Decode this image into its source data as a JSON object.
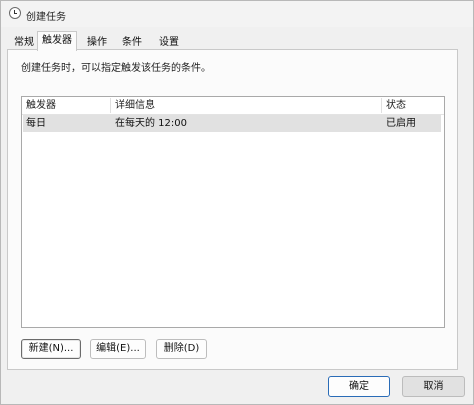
{
  "window": {
    "title": "创建任务",
    "icon": "clock-icon"
  },
  "tabs": [
    {
      "label": "常规",
      "active": false
    },
    {
      "label": "触发器",
      "active": true
    },
    {
      "label": "操作",
      "active": false
    },
    {
      "label": "条件",
      "active": false
    },
    {
      "label": "设置",
      "active": false
    }
  ],
  "triggers": {
    "description": "创建任务时，可以指定触发该任务的条件。",
    "columns": [
      "触发器",
      "详细信息",
      "状态"
    ],
    "rows": [
      {
        "trigger": "每日",
        "details": "在每天的 12:00",
        "status": "已启用",
        "selected": true
      }
    ],
    "buttons": {
      "new": "新建(N)...",
      "edit": "编辑(E)...",
      "delete": "删除(D)"
    }
  },
  "footer": {
    "ok": "确定",
    "cancel": "取消"
  },
  "colors": {
    "selected_row": "#e1e1e1",
    "primary_border": "#2a6cb7",
    "window_bg": "#f0f0f0"
  }
}
